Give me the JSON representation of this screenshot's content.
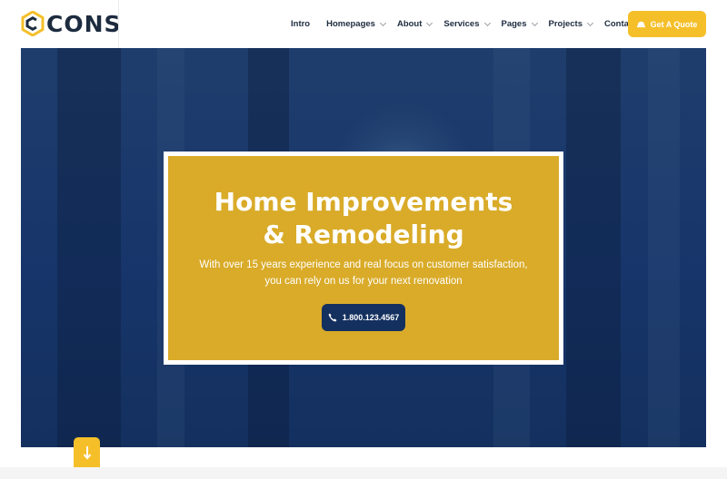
{
  "brand": {
    "name": "CONS",
    "logo_icon": "c-hexagon-logo",
    "accent_color": "#f5bf2a",
    "dark_color": "#1d2b3f"
  },
  "nav": {
    "items": [
      {
        "label": "Intro",
        "has_dropdown": false
      },
      {
        "label": "Homepages",
        "has_dropdown": true
      },
      {
        "label": "About",
        "has_dropdown": true
      },
      {
        "label": "Services",
        "has_dropdown": true
      },
      {
        "label": "Pages",
        "has_dropdown": true
      },
      {
        "label": "Projects",
        "has_dropdown": true
      },
      {
        "label": "Contact",
        "has_dropdown": true
      }
    ],
    "cta": {
      "label": "Get A Quote",
      "icon": "hard-hat-icon"
    }
  },
  "hero": {
    "title_line1": "Home Improvements",
    "title_line2": "& Remodeling",
    "subtitle_line1": "With over 15 years experience and real focus on customer satisfaction,",
    "subtitle_line2": "you can rely on us for your next renovation",
    "phone": {
      "label": "1.800.123.4567",
      "icon": "phone-icon"
    },
    "card_color": "#d9ab29",
    "overlay_color": "#14305f"
  },
  "scroll_button": {
    "icon": "arrow-down-icon"
  }
}
